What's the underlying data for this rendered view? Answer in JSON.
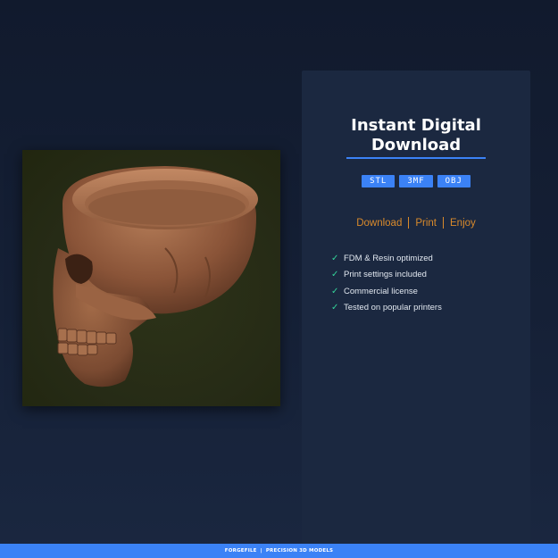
{
  "product_image": {
    "alt_icon": "skull-planter-render"
  },
  "panel": {
    "title_line1": "Instant Digital",
    "title_line2": "Download",
    "formats": [
      "STL",
      "3MF",
      "OBJ"
    ],
    "tagline": [
      "Download",
      "Print",
      "Enjoy"
    ],
    "features": [
      "FDM & Resin optimized",
      "Print settings included",
      "Commercial license",
      "Tested on popular printers"
    ],
    "check_icon": "check-icon"
  },
  "footer": {
    "brand": "FORGEFILE",
    "separator": "|",
    "tagline": "PRECISION 3D MODELS"
  },
  "colors": {
    "accent": "#3b82f6",
    "tagline": "#d98a2b",
    "check": "#34d399",
    "panel_bg": "#1b2840"
  }
}
